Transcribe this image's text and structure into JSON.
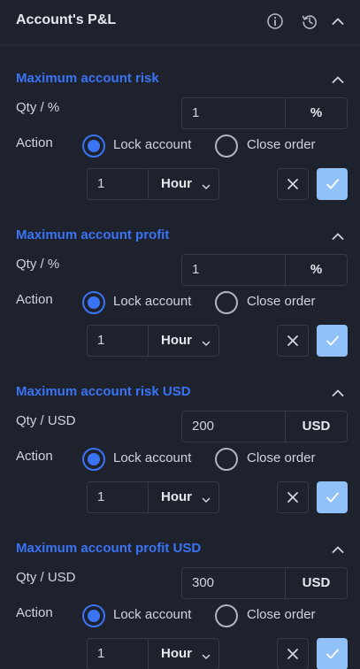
{
  "header": {
    "title": "Account's P&L",
    "icons": [
      "info-icon",
      "history-icon",
      "chevron-up-icon"
    ]
  },
  "colors": {
    "background": "#1e222d",
    "section_title": "#3b73f5",
    "radio_active": "#3b73f5",
    "confirm_button": "#90c2f9",
    "border": "#363a45"
  },
  "sections": [
    {
      "title": "Maximum account risk",
      "qty_label": "Qty / %",
      "qty_value": "1",
      "qty_unit": "%",
      "action_label": "Action",
      "options": [
        "Lock account",
        "Close order"
      ],
      "selected_option": "Lock account",
      "duration_value": "1",
      "duration_unit": "Hour"
    },
    {
      "title": "Maximum account profit",
      "qty_label": "Qty / %",
      "qty_value": "1",
      "qty_unit": "%",
      "action_label": "Action",
      "options": [
        "Lock account",
        "Close order"
      ],
      "selected_option": "Lock account",
      "duration_value": "1",
      "duration_unit": "Hour"
    },
    {
      "title": "Maximum account risk USD",
      "qty_label": "Qty / USD",
      "qty_value": "200",
      "qty_unit": "USD",
      "action_label": "Action",
      "options": [
        "Lock account",
        "Close order"
      ],
      "selected_option": "Lock account",
      "duration_value": "1",
      "duration_unit": "Hour"
    },
    {
      "title": "Maximum account profit USD",
      "qty_label": "Qty / USD",
      "qty_value": "300",
      "qty_unit": "USD",
      "action_label": "Action",
      "options": [
        "Lock account",
        "Close order"
      ],
      "selected_option": "Lock account",
      "duration_value": "1",
      "duration_unit": "Hour"
    }
  ]
}
